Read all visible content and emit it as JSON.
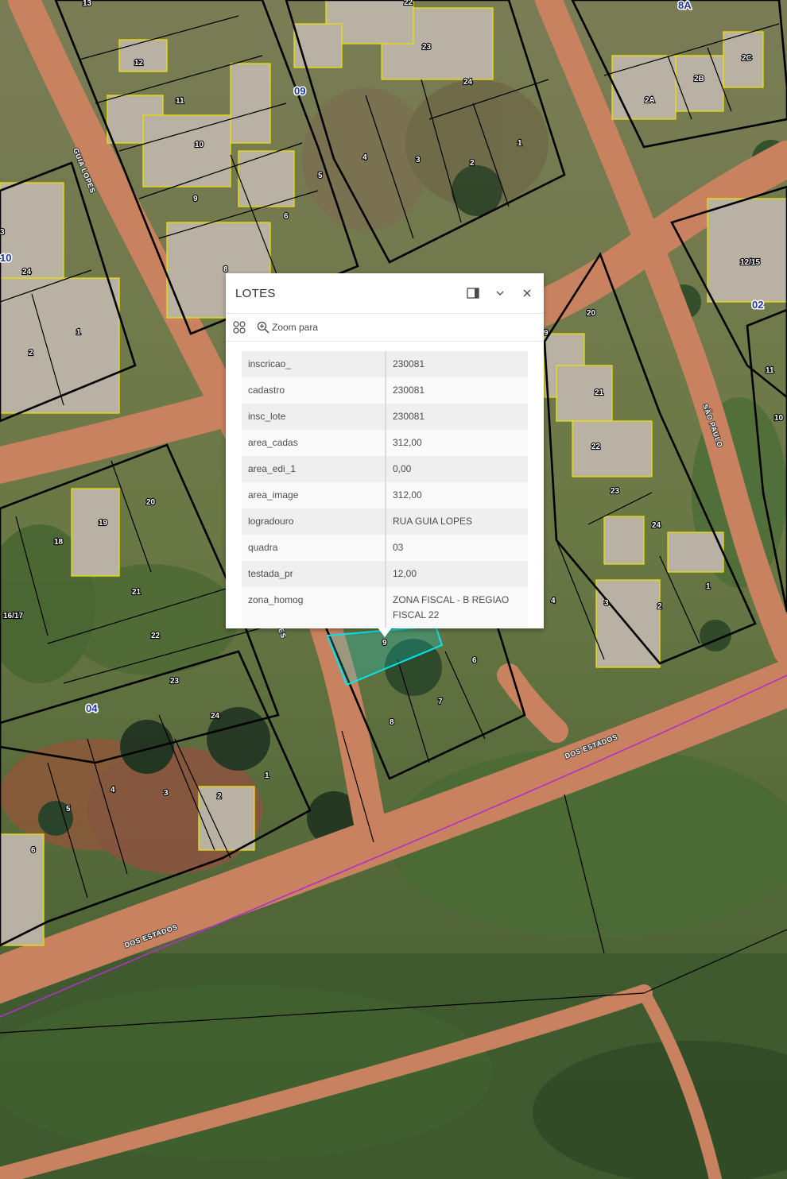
{
  "popup": {
    "title": "LOTES",
    "dock_icon": "dock-icon",
    "collapse_icon": "chevron-down-icon",
    "close_icon": "close-icon",
    "actions_icon": "actions-grid-icon",
    "zoom_label": "Zoom para",
    "attributes": [
      {
        "key": "inscricao_",
        "value": "230081"
      },
      {
        "key": "cadastro",
        "value": "230081"
      },
      {
        "key": "insc_lote",
        "value": "230081"
      },
      {
        "key": "area_cadas",
        "value": "312,00"
      },
      {
        "key": "area_edi_1",
        "value": "0,00"
      },
      {
        "key": "area_image",
        "value": "312,00"
      },
      {
        "key": "logradouro",
        "value": "RUA GUIA LOPES"
      },
      {
        "key": "quadra",
        "value": "03"
      },
      {
        "key": "testada_pr",
        "value": "12,00"
      },
      {
        "key": "zona_homog",
        "value": "ZONA FISCAL - B REGIAO FISCAL 22"
      }
    ]
  },
  "map": {
    "streets": {
      "guia_lopes": "GUIA LOPES",
      "sao_paulo": "SÃO PAULO",
      "dos_estados_1": "DOS ESTADOS",
      "dos_estados_2": "DOS ESTADOS",
      "guia_fragment": "ES"
    },
    "quadras": {
      "q09": "09",
      "q8a": "8A",
      "q10": "10",
      "q02": "02",
      "q04": "04"
    },
    "lots": {
      "l13": "13",
      "l22top": "22",
      "l12": "12",
      "l11": "11",
      "l10": "10",
      "l9a": "9",
      "l8a": "8",
      "l23a": "23",
      "l24a": "24",
      "l4a": "4",
      "l3a": "3",
      "l2a": "2",
      "l1a": "1",
      "l5a": "5",
      "l6a": "6",
      "l2A": "2A",
      "l2B": "2B",
      "l2C": "2C",
      "l1215": "12/15",
      "l3b": "3",
      "l24b": "24",
      "l1b": "1",
      "l2b": "2",
      "l11b": "11",
      "l10b": "10",
      "l20a": "20",
      "l19": "19",
      "l18": "18",
      "l1617": "16/17",
      "l21a": "21",
      "l22a": "22",
      "l23b": "23",
      "l24c": "24",
      "l1c": "1",
      "l2c": "2",
      "l3c": "3",
      "l4c": "4",
      "l5c": "5",
      "l6c": "6",
      "l9sel": "9",
      "l6d": "6",
      "l7": "7",
      "l8b": "8",
      "l20b": "20",
      "l9b": "9",
      "l21b": "21",
      "l22b": "22",
      "l23c": "23",
      "l24d": "24",
      "l1d": "1",
      "l2d": "2",
      "l3d": "3",
      "l4d": "4"
    },
    "colors": {
      "selection": "#00e5ef",
      "boundary": "#b030c8",
      "building_outline": "#e8e000"
    }
  }
}
